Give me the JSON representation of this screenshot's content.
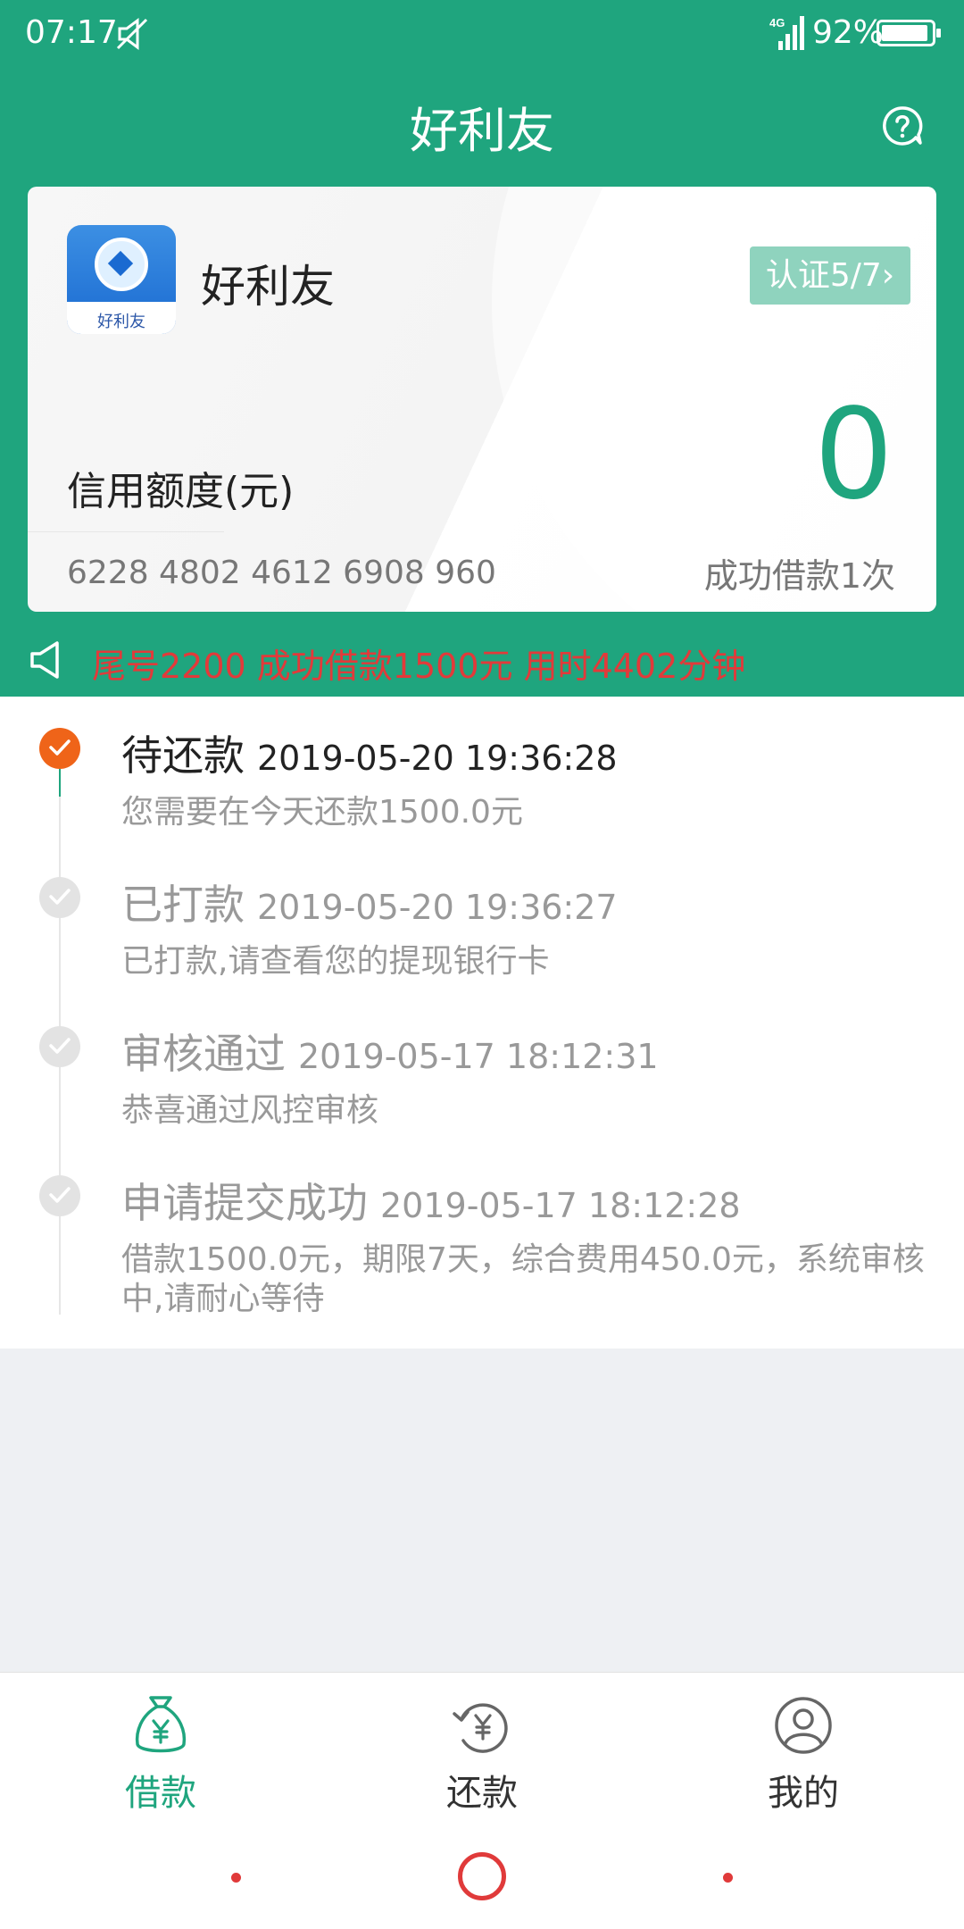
{
  "status_bar": {
    "time": "07:17",
    "battery": "92%",
    "network": "4G"
  },
  "header": {
    "title": "好利友"
  },
  "card": {
    "app_name": "好利友",
    "logo_text": "好利友",
    "cert_label": "认证5/7",
    "credit_label": "信用额度(元)",
    "credit_amount": "0",
    "card_number": "6228 4802 4612 6908 960",
    "success_count": "成功借款1次"
  },
  "notice": {
    "text": "尾号2200 成功借款1500元 用时4402分钟"
  },
  "timeline": [
    {
      "title": "待还款",
      "datetime": "2019-05-20 19:36:28",
      "desc": "您需要在今天还款1500.0元",
      "active": true
    },
    {
      "title": "已打款",
      "datetime": "2019-05-20 19:36:27",
      "desc": "已打款,请查看您的提现银行卡",
      "active": false
    },
    {
      "title": "审核通过",
      "datetime": "2019-05-17 18:12:31",
      "desc": "恭喜通过风控审核",
      "active": false
    },
    {
      "title": "申请提交成功",
      "datetime": "2019-05-17 18:12:28",
      "desc": "借款1500.0元，期限7天，综合费用450.0元，系统审核中,请耐心等待",
      "active": false
    }
  ],
  "bottom_nav": [
    {
      "label": "借款",
      "icon": "money-bag-icon",
      "active": true
    },
    {
      "label": "还款",
      "icon": "repay-icon",
      "active": false
    },
    {
      "label": "我的",
      "icon": "user-icon",
      "active": false
    }
  ],
  "colors": {
    "brand_green": "#1fa57e",
    "active_orange": "#ef6419",
    "notice_red": "#e23a3a"
  }
}
